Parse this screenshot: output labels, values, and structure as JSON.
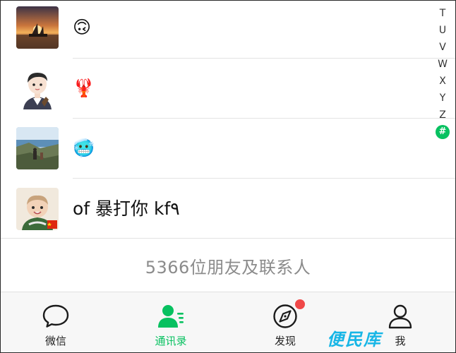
{
  "contacts": [
    {
      "name": "🙃",
      "avatar": "sunset-ship-photo"
    },
    {
      "name": "🦞",
      "avatar": "cartoon-boy-illustration"
    },
    {
      "name": "🥶",
      "avatar": "coastal-landscape-photo"
    },
    {
      "name": "of 暴打你 kf٩",
      "avatar": "child-portrait-photo"
    }
  ],
  "contact_count": "5366位朋友及联系人",
  "index_letters": [
    "T",
    "U",
    "V",
    "W",
    "X",
    "Y",
    "Z",
    "#"
  ],
  "tabs": [
    {
      "label": "微信",
      "icon": "chat-bubble-icon"
    },
    {
      "label": "通讯录",
      "icon": "contacts-icon"
    },
    {
      "label": "发现",
      "icon": "compass-icon"
    },
    {
      "label": "我",
      "icon": "person-icon"
    }
  ],
  "watermark": "便民库",
  "colors": {
    "accent": "#07c160",
    "badge": "#f04848",
    "watermark": "#18b6e6"
  }
}
